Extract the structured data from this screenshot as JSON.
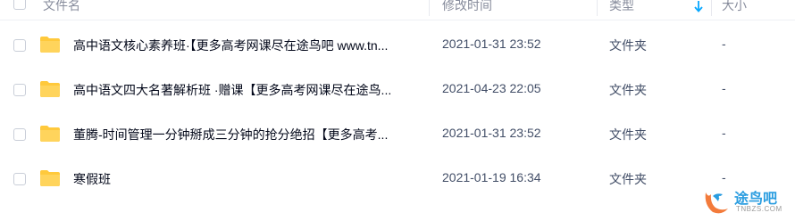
{
  "header": {
    "name_label": "文件名",
    "time_label": "修改时间",
    "type_label": "类型",
    "size_label": "大小",
    "sort_icon": "arrow-down-icon"
  },
  "files": [
    {
      "name": "高中语文核心素养班·【更多高考网课尽在途鸟吧 www.tn...",
      "modified": "2021-01-31 23:52",
      "type": "文件夹",
      "size": "-"
    },
    {
      "name": "高中语文四大名著解析班 ·赠课【更多高考网课尽在途鸟...",
      "modified": "2021-04-23 22:05",
      "type": "文件夹",
      "size": "-"
    },
    {
      "name": "董腾-时间管理一分钟掰成三分钟的抢分绝招【更多高考...",
      "modified": "2021-01-31 23:52",
      "type": "文件夹",
      "size": "-"
    },
    {
      "name": "寒假班",
      "modified": "2021-01-19 16:34",
      "type": "文件夹",
      "size": "-"
    }
  ],
  "watermark": {
    "text": "途鸟吧",
    "url": "TNBZS.COM"
  },
  "colors": {
    "folder": "#ffc93c",
    "accent": "#06a7ff",
    "text": "#03081a",
    "muted": "#424e67"
  }
}
